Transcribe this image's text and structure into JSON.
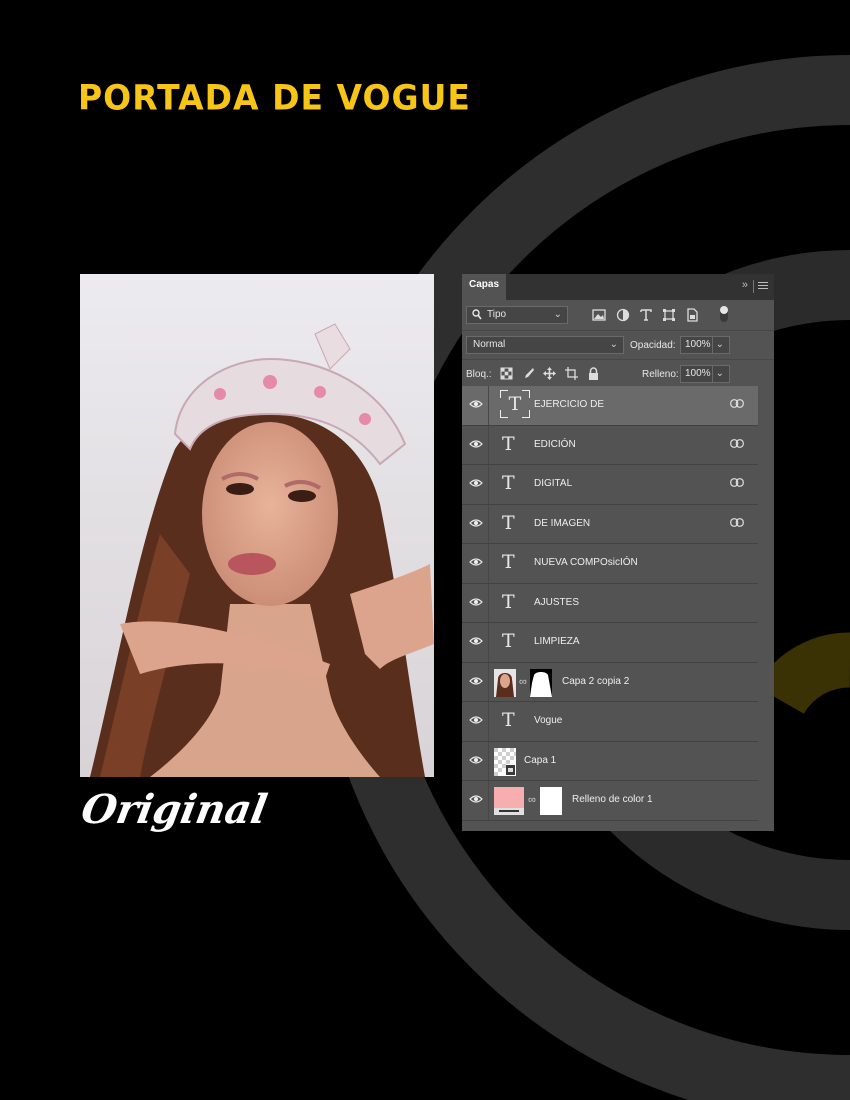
{
  "title": "PORTADA DE VOGUE",
  "caption": "Original",
  "colors": {
    "accent": "#f7c418",
    "background": "#000000",
    "arc": "#323232",
    "panel": "#535353",
    "swatch": "#f7aeae"
  },
  "panel": {
    "tab": "Capas",
    "filter_kind": "Tipo",
    "blend_mode": "Normal",
    "opacity_label": "Opacidad:",
    "opacity_value": "100%",
    "lock_label": "Bloq.:",
    "fill_label": "Relleno:",
    "fill_value": "100%",
    "filter_icons": [
      "image-filter-icon",
      "adjustment-filter-icon",
      "type-filter-icon",
      "shape-filter-icon",
      "smart-object-filter-icon"
    ],
    "lock_icons": [
      "lock-transparency-icon",
      "lock-pixels-icon",
      "lock-position-icon",
      "lock-artboard-icon",
      "lock-all-icon"
    ]
  },
  "layers": [
    {
      "name": "EJERCICIO DE",
      "kind": "text",
      "linked": true,
      "selected": true
    },
    {
      "name": "EDICIÓN",
      "kind": "text",
      "linked": true
    },
    {
      "name": "DIGITAL",
      "kind": "text",
      "linked": true
    },
    {
      "name": "DE IMAGEN",
      "kind": "text",
      "linked": true
    },
    {
      "name": "NUEVA COMPOsicIÓN",
      "kind": "text",
      "linked": false
    },
    {
      "name": "AJUSTES",
      "kind": "text",
      "linked": false
    },
    {
      "name": "LIMPIEZA",
      "kind": "text",
      "linked": false
    },
    {
      "name": "Capa 2 copia 2",
      "kind": "masked-image",
      "linked": false
    },
    {
      "name": "Vogue",
      "kind": "text",
      "linked": false
    },
    {
      "name": "Capa 1",
      "kind": "smart-object",
      "linked": false
    },
    {
      "name": "Relleno de color 1",
      "kind": "fill",
      "linked": false
    }
  ]
}
